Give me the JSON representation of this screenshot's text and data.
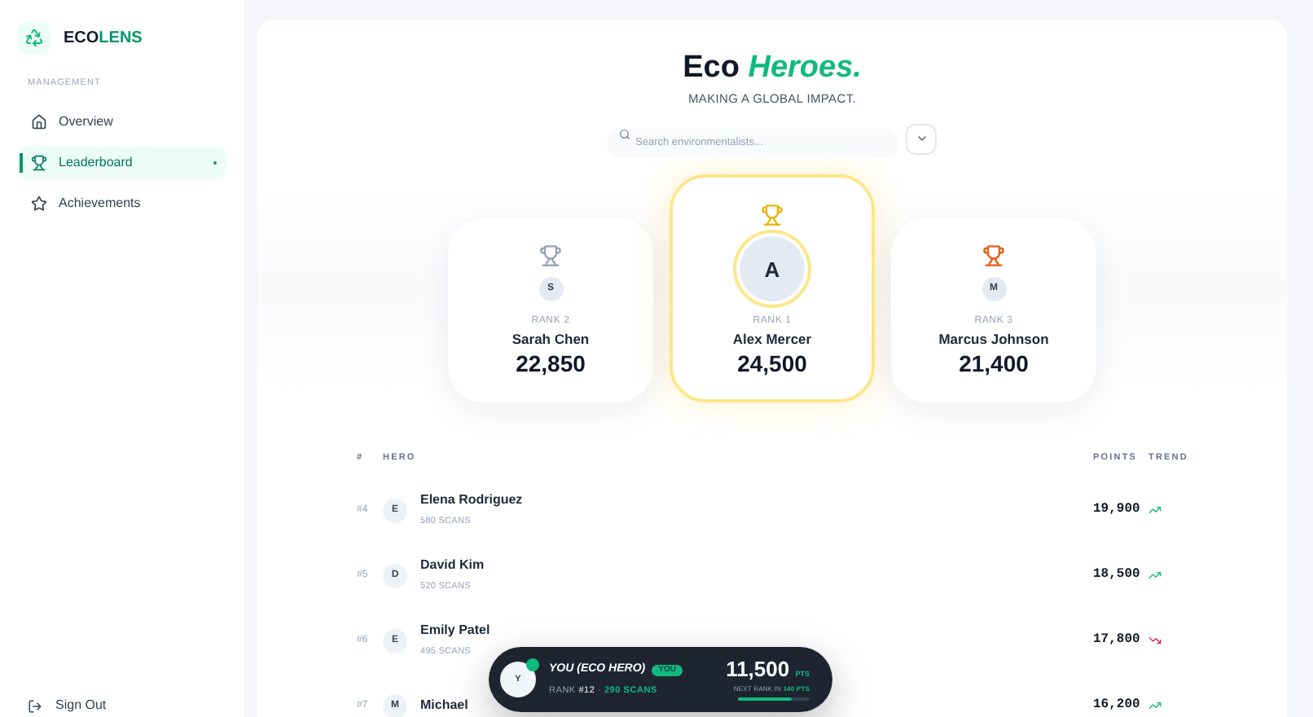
{
  "brand": {
    "prefix": "ECO",
    "suffix": "LENS"
  },
  "sidebar": {
    "section": "MANAGEMENT",
    "items": [
      {
        "label": "Overview",
        "kind": "home",
        "selected": false
      },
      {
        "label": "Leaderboard",
        "kind": "trophy",
        "selected": true
      },
      {
        "label": "Achievements",
        "kind": "star",
        "selected": false
      }
    ],
    "sign_out": "Sign Out"
  },
  "header": {
    "title": "Eco",
    "title_accent": "Heroes.",
    "subtitle": "MAKING A GLOBAL IMPACT."
  },
  "search": {
    "placeholder": "Search environmentalists..."
  },
  "podium": [
    {
      "rank": "RANK 2",
      "name": "Sarah Chen",
      "points": "22,850",
      "initial": "S",
      "kind": "silver"
    },
    {
      "rank": "RANK 1",
      "name": "Alex Mercer",
      "points": "24,500",
      "initial": "A",
      "kind": "gold"
    },
    {
      "rank": "RANK 3",
      "name": "Marcus Johnson",
      "points": "21,400",
      "initial": "M",
      "kind": "bronze"
    }
  ],
  "table": {
    "columns": [
      "#",
      "HERO",
      "POINTS",
      "TREND"
    ],
    "rows": [
      {
        "rank": "#4",
        "initial": "E",
        "name": "Elena Rodriguez",
        "scans": "580 SCANS",
        "points": "19,900",
        "kind": "up"
      },
      {
        "rank": "#5",
        "initial": "D",
        "name": "David Kim",
        "scans": "520 SCANS",
        "points": "18,500",
        "kind": "up"
      },
      {
        "rank": "#6",
        "initial": "E",
        "name": "Emily Patel",
        "scans": "495 SCANS",
        "points": "17,800",
        "kind": "down"
      },
      {
        "rank": "#7",
        "initial": "M",
        "name": "Michael",
        "points": "16,200",
        "kind": "up"
      }
    ]
  },
  "you": {
    "initial": "Y",
    "name": "YOU (ECO HERO)",
    "badge": "YOU",
    "rank_label": "RANK",
    "rank": "#12",
    "separator": "·",
    "scans": "290 SCANS",
    "points": "11,500",
    "unit": "PTS",
    "next_label": "NEXT RANK IN",
    "next_value": "140 PTS",
    "level": 0.75
  }
}
